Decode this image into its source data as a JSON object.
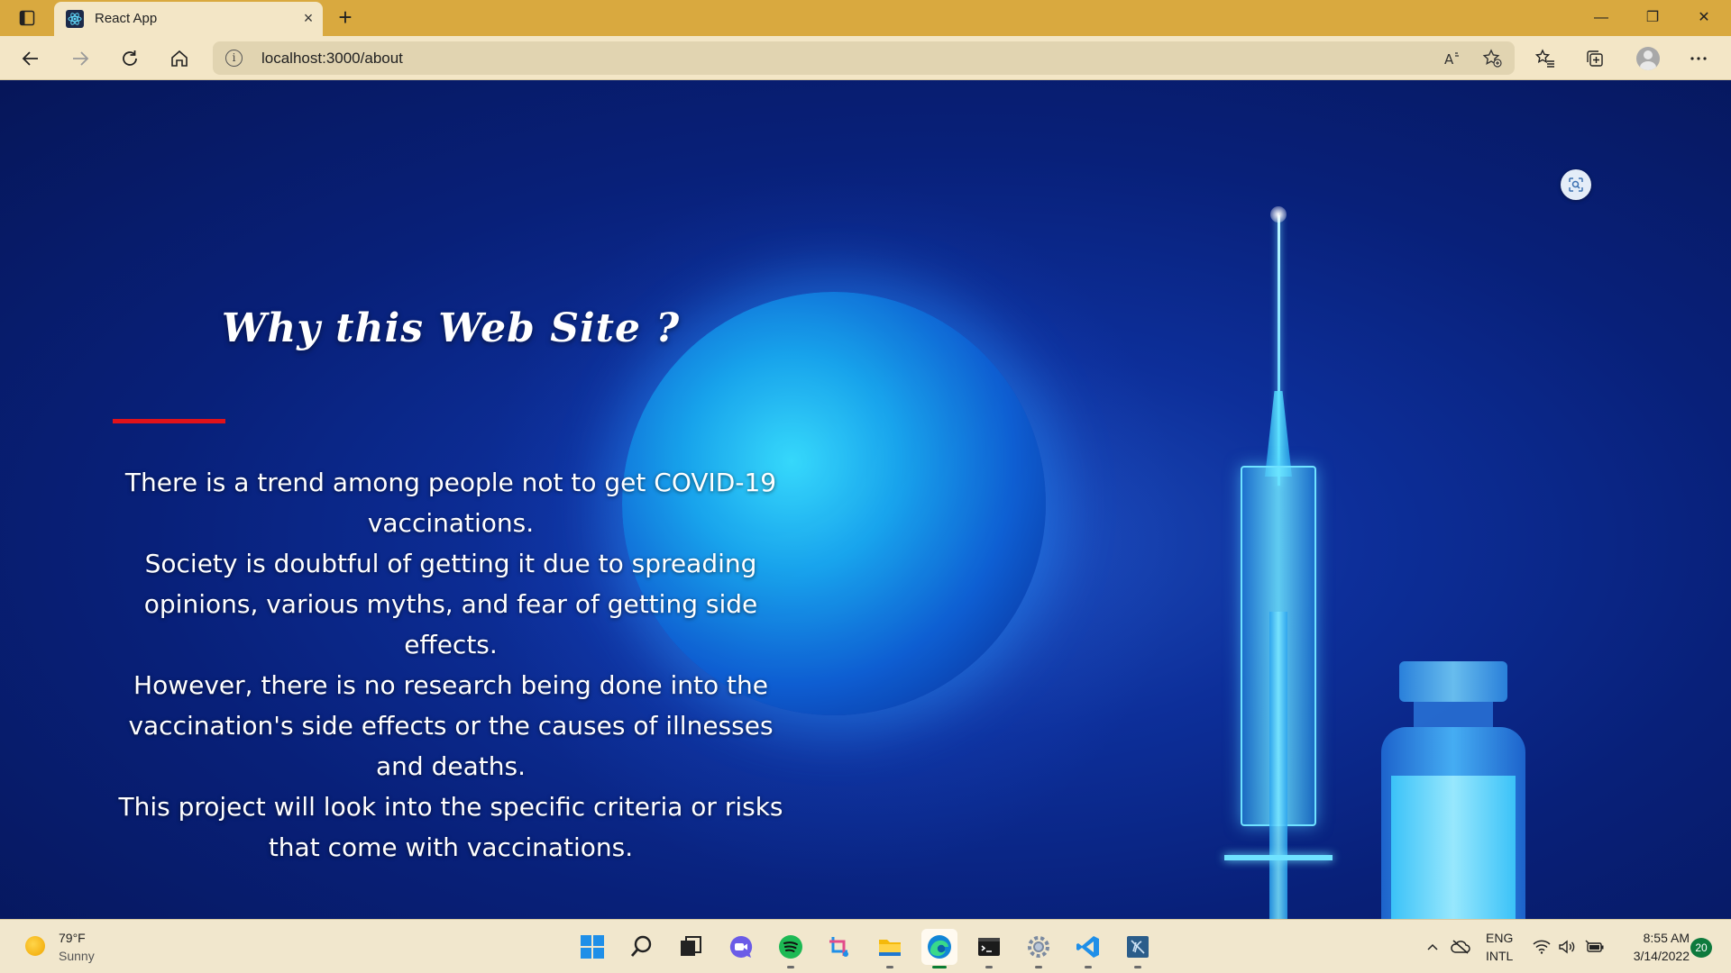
{
  "browser": {
    "tab_title": "React App",
    "tab_close": "×",
    "new_tab": "+",
    "url": "localhost:3000/about",
    "window_controls": {
      "minimize": "—",
      "restore": "❐",
      "close": "✕"
    }
  },
  "page": {
    "headline": "Why this Web Site ?",
    "paragraphs": [
      "There is a trend among people not to get COVID-19 vaccinations.",
      "Society is doubtful of getting it due to spreading opinions, various myths, and fear of getting side effects.",
      "However, there is no research being done into the vaccination's side effects or the causes of illnesses and deaths.",
      "This project will look into the specific criteria or risks that come with vaccinations."
    ],
    "accent_color": "#e0121a"
  },
  "taskbar": {
    "weather": {
      "temp": "79°F",
      "condition": "Sunny"
    },
    "apps": [
      "start-icon",
      "search-icon",
      "task-view-icon",
      "chat-icon",
      "spotify-icon",
      "snipping-tool-icon",
      "file-explorer-icon",
      "edge-icon",
      "terminal-icon",
      "settings-icon",
      "vscode-icon",
      "ssms-icon"
    ],
    "language": {
      "line1": "ENG",
      "line2": "INTL"
    },
    "clock": {
      "time": "8:55 AM",
      "date": "3/14/2022"
    },
    "notifications": "20"
  }
}
